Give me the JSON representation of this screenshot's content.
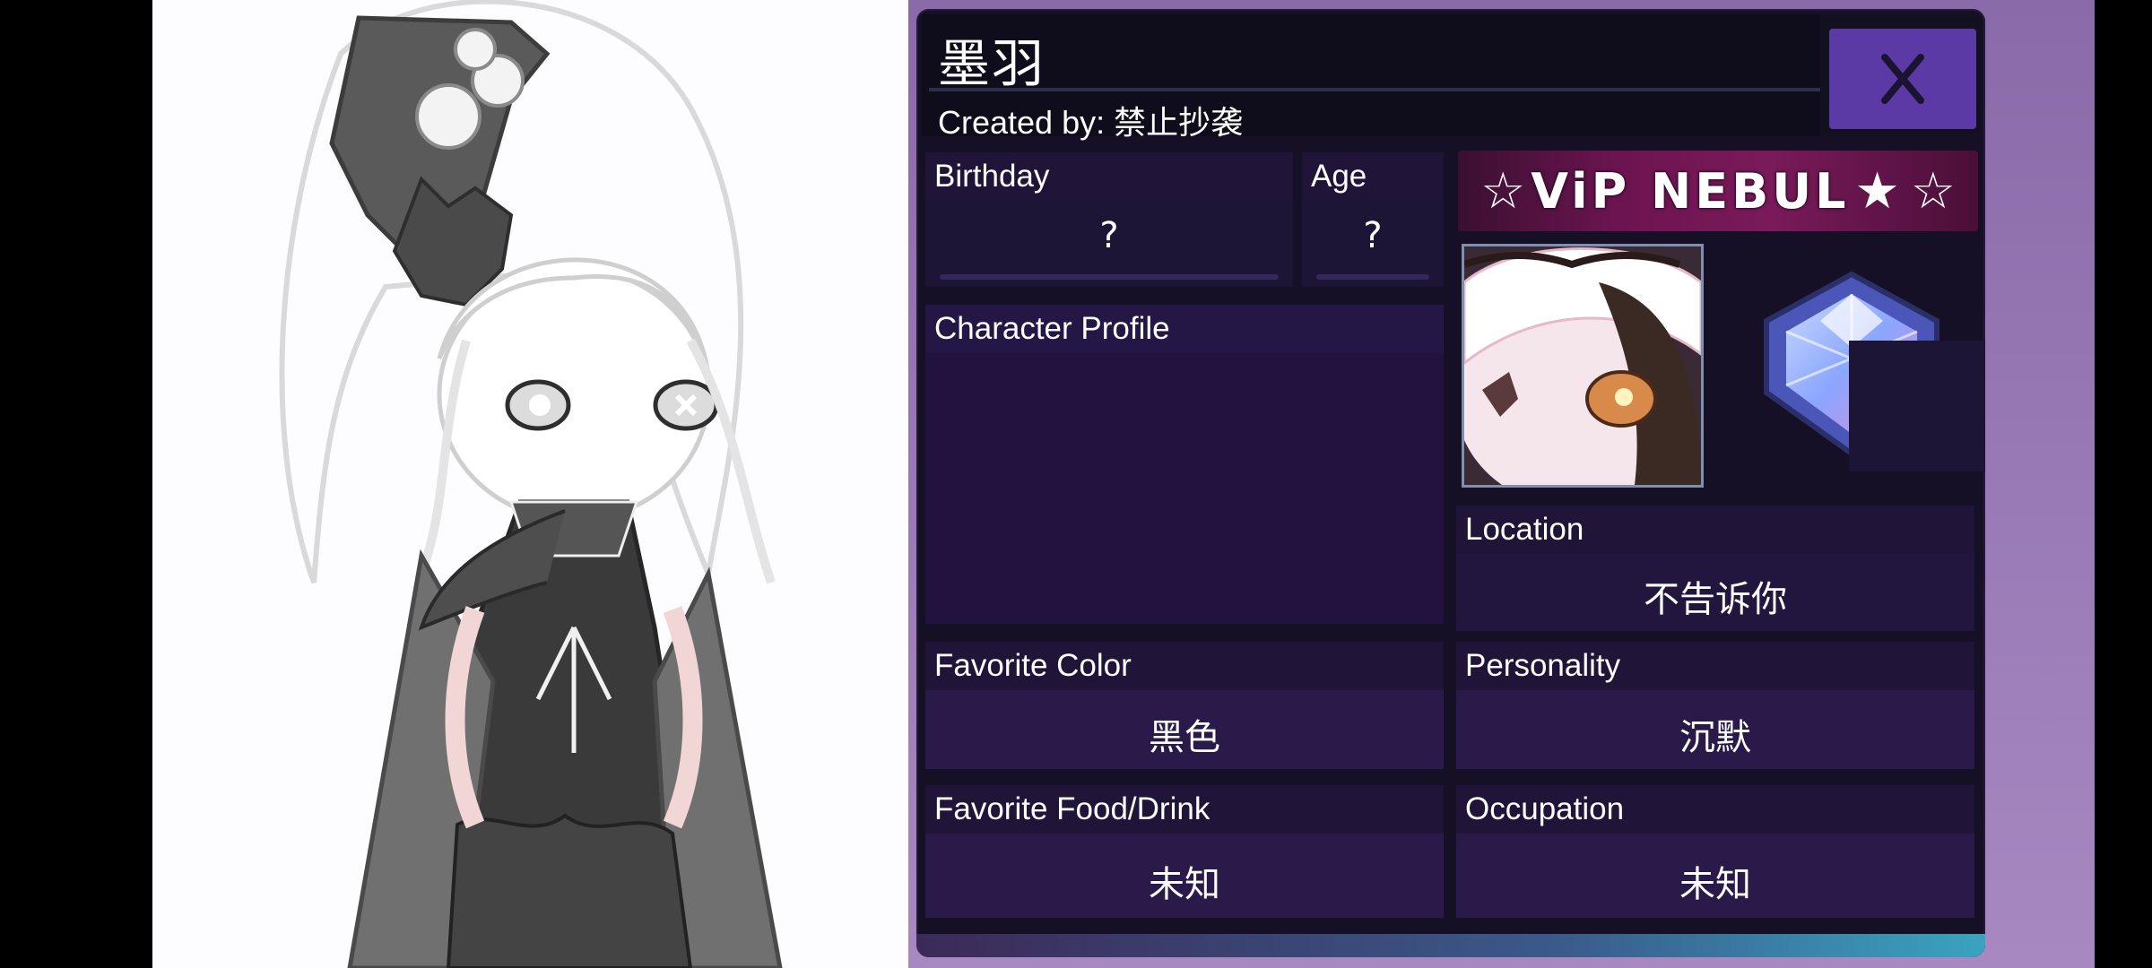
{
  "character": {
    "name": "墨羽",
    "created_by": "Created by: 禁止抄袭"
  },
  "close_button": {
    "label": "X"
  },
  "fields": {
    "birthday": {
      "label": "Birthday",
      "value": "?"
    },
    "age": {
      "label": "Age",
      "value": "?"
    },
    "profile": {
      "label": "Character Profile",
      "value": ""
    },
    "location": {
      "label": "Location",
      "value": "不告诉你"
    },
    "favorite_color": {
      "label": "Favorite Color",
      "value": "黑色"
    },
    "personality": {
      "label": "Personality",
      "value": "沉默"
    },
    "favorite_food": {
      "label": "Favorite Food/Drink",
      "value": "未知"
    },
    "occupation": {
      "label": "Occupation",
      "value": "未知"
    }
  },
  "badge": {
    "text": "ViP NEBUL"
  },
  "icons": {
    "close": "close-icon",
    "badge_star": "star-icon",
    "rank_gem": "gem-icon",
    "avatar": "character-portrait"
  },
  "colors": {
    "panel_bg": "#161026",
    "close_accent": "#5b3aa6",
    "vip_banner": "#7a1a5a",
    "value_box": "#2a1a4a"
  }
}
